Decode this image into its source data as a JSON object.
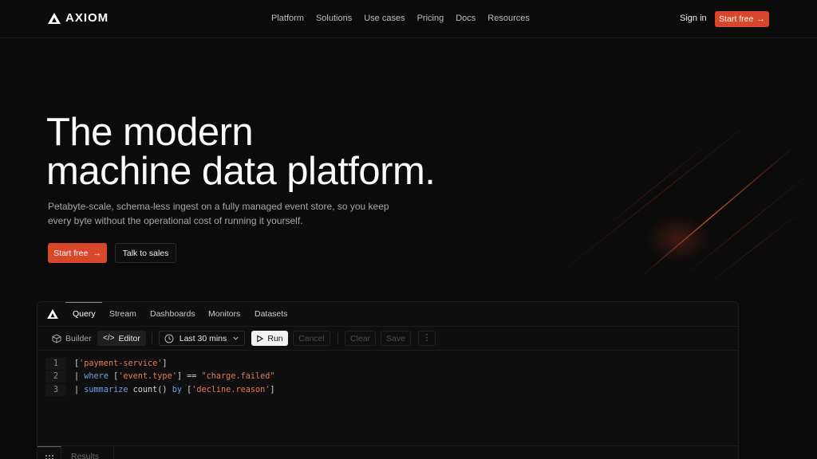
{
  "brand": {
    "name": "AXIOM"
  },
  "nav": {
    "links": [
      "Platform",
      "Solutions",
      "Use cases",
      "Pricing",
      "Docs",
      "Resources"
    ],
    "signin": "Sign in",
    "cta": "Start free",
    "cta_icon": "arrow-right-icon"
  },
  "hero": {
    "title_line1": "The modern",
    "title_line2": "machine data platform.",
    "subtitle": "Petabyte-scale, schema-less ingest on a fully managed event store, so you keep every byte without the operational cost of running it yourself.",
    "primary_button": "Start free",
    "secondary_button": "Talk to sales"
  },
  "app": {
    "tabs": [
      "Query",
      "Stream",
      "Dashboards",
      "Monitors",
      "Datasets"
    ],
    "active_tab": "Query",
    "toolbar": {
      "builder": "Builder",
      "editor": "Editor",
      "time_range": "Last 30 mins",
      "run": "Run",
      "cancel": "Cancel",
      "clear": "Clear",
      "save": "Save"
    },
    "code_lines": [
      {
        "num": "1",
        "text": "['payment-service']"
      },
      {
        "num": "2",
        "text": "| where ['event.type'] == \"charge.failed\""
      },
      {
        "num": "3",
        "text": "| summarize count() by ['decline.reason']"
      }
    ],
    "results_tab": "Results"
  },
  "colors": {
    "accent": "#d9472a",
    "background": "#0b0b0b",
    "string": "#e87a57",
    "keyword": "#6f9fe8"
  }
}
